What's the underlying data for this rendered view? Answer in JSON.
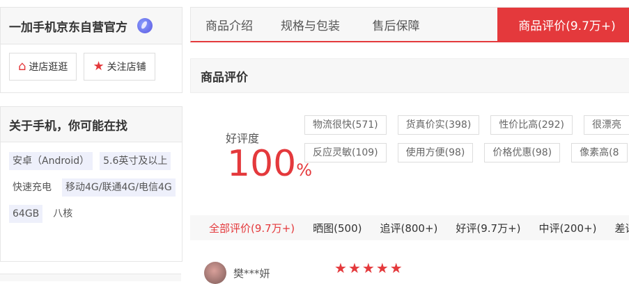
{
  "store": {
    "name": "一加手机京东自营官方",
    "buttons": [
      {
        "icon": "home-icon",
        "label": "进店逛逛"
      },
      {
        "icon": "star-icon",
        "label": "关注店铺"
      }
    ]
  },
  "guess": {
    "title": "关于手机，你可能在找",
    "tags": [
      "安卓（Android）",
      "5.6英寸及以上",
      "快速充电",
      "移动4G/联通4G/电信4G",
      "64GB",
      "八核"
    ]
  },
  "tabs": [
    "商品介绍",
    "规格与包装",
    "售后保障",
    "商品评价(9.7万+)"
  ],
  "active_tab": "商品评价(9.7万+)",
  "section": {
    "title": "商品评价"
  },
  "rating": {
    "label": "好评度",
    "value": "100",
    "unit": "%"
  },
  "chips": [
    [
      "物流很快(571)",
      "货真价实(398)",
      "性价比高(292)",
      "很漂亮"
    ],
    [
      "反应灵敏(109)",
      "使用方便(98)",
      "价格优惠(98)",
      "像素高(8"
    ]
  ],
  "filters": [
    "全部评价(9.7万+)",
    "晒图(500)",
    "追评(800+)",
    "好评(9.7万+)",
    "中评(200+)",
    "差评"
  ],
  "review": {
    "user": "樊***妍",
    "stars": 5
  },
  "colors": {
    "accent": "#e4393c"
  }
}
